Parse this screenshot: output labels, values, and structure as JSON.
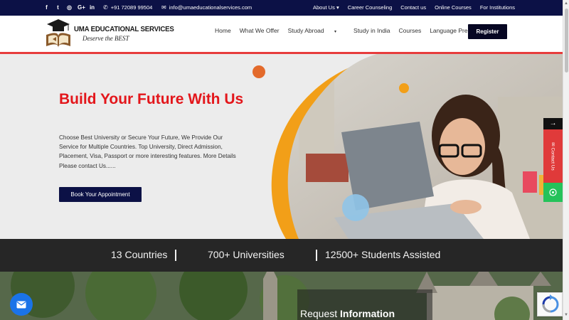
{
  "topbar": {
    "social_icons": [
      "facebook-icon",
      "twitter-icon",
      "instagram-icon",
      "google-plus-icon",
      "linkedin-icon"
    ],
    "phone": "+91 72089 99504",
    "email": "info@umaeducationalservices.com",
    "nav": [
      "About Us",
      "Career Counseling",
      "Contact us",
      "Online Courses",
      "For Institutions"
    ]
  },
  "brand": {
    "name": "UMA EDUCATIONAL SERVICES",
    "tagline": "Deserve the BEST"
  },
  "nav": {
    "items": [
      "Home",
      "What We Offer",
      "Study Abroad",
      "Study in India",
      "Courses",
      "Language Preparation"
    ],
    "register_label": "Register"
  },
  "hero": {
    "title": "Build Your Future With Us",
    "description": "Choose Best University or Secure Your Future, We Provide Our Service for Multiple Countries. Top University, Direct Admission, Placement, Visa, Passport or more interesting features. More Details Please contact Us......",
    "button_label": "Book Your Appointment"
  },
  "stats": [
    "13 Countries",
    "700+ Universities",
    "12500+ Students Assisted"
  ],
  "request": {
    "light": "Request",
    "bold": "Information"
  },
  "side": {
    "arrow": "→",
    "contact_label": "✉ Contact Us",
    "whatsapp_icon": "whatsapp-icon"
  },
  "colors": {
    "navy": "#0c1146",
    "red": "#e3161b",
    "orange": "#e8702a",
    "blue_ring": "#8fc4e8",
    "whatsapp": "#25c25a"
  }
}
